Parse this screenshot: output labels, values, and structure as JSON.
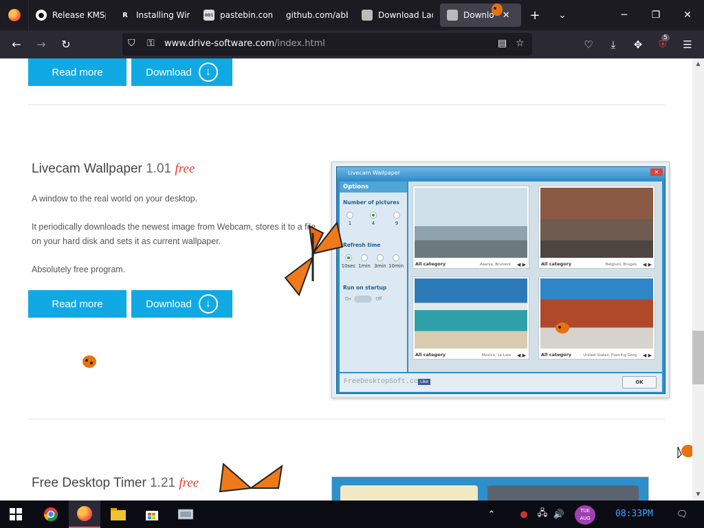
{
  "browser": {
    "tabs": [
      {
        "label": "Release KMSp",
        "icon": "github-icon"
      },
      {
        "label": "Installing Win",
        "icon": "r-icon"
      },
      {
        "label": "pastebin.com/",
        "icon": "pastebin-icon"
      },
      {
        "label": "github.com/abbo",
        "icon": "none"
      },
      {
        "label": "Download Lad",
        "icon": "site-icon"
      },
      {
        "label": "Downlo",
        "icon": "site-icon"
      }
    ],
    "url_domain": "www.drive-software.com",
    "url_path": "/index.html",
    "extension_badge": "5"
  },
  "page": {
    "top_buttons": {
      "read_more": "Read more",
      "download": "Download"
    },
    "product1": {
      "name": "Livecam Wallpaper",
      "version": "1.01",
      "free_label": "free",
      "desc1": "A window to the real world on your desktop.",
      "desc2": "It periodically downloads the newest image from Webcam, stores it to a file on your hard disk and sets it as current wallpaper.",
      "desc3": "Absolutely free program.",
      "read_more": "Read more",
      "download": "Download"
    },
    "screenshot": {
      "window_title": "Livecam Wallpaper",
      "options_header": "Options",
      "num_pictures_label": "Number of pictures",
      "num_pictures_opts": [
        "1",
        "4",
        "9"
      ],
      "refresh_label": "Refresh time",
      "refresh_opts": [
        "10sec",
        "1min",
        "3min",
        "10min"
      ],
      "startup_label": "Run on startup",
      "startup_on": "On",
      "startup_off": "Off",
      "tiles": [
        {
          "cap": "All category",
          "loc": "Aaanla, Bruneck"
        },
        {
          "cap": "All category",
          "loc": "Belgium, Bruges"
        },
        {
          "cap": "All category",
          "loc": "Mexico, La Lala"
        },
        {
          "cap": "All category",
          "loc": "United States, Flaming Gorg"
        }
      ],
      "footer_brand": "FreeDesktopSoft.com",
      "like": "Like",
      "ok": "OK"
    },
    "product2": {
      "name": "Free Desktop Timer",
      "version": "1.21",
      "free_label": "free"
    }
  },
  "taskbar": {
    "day_top": "TUE",
    "day_bottom": "AUG",
    "clock": "08:33PM"
  },
  "colors": {
    "accent_blue": "#11a9e3",
    "free_red": "#e6392b",
    "tabbar": "#1c1b22",
    "navbar": "#2b2a33"
  }
}
